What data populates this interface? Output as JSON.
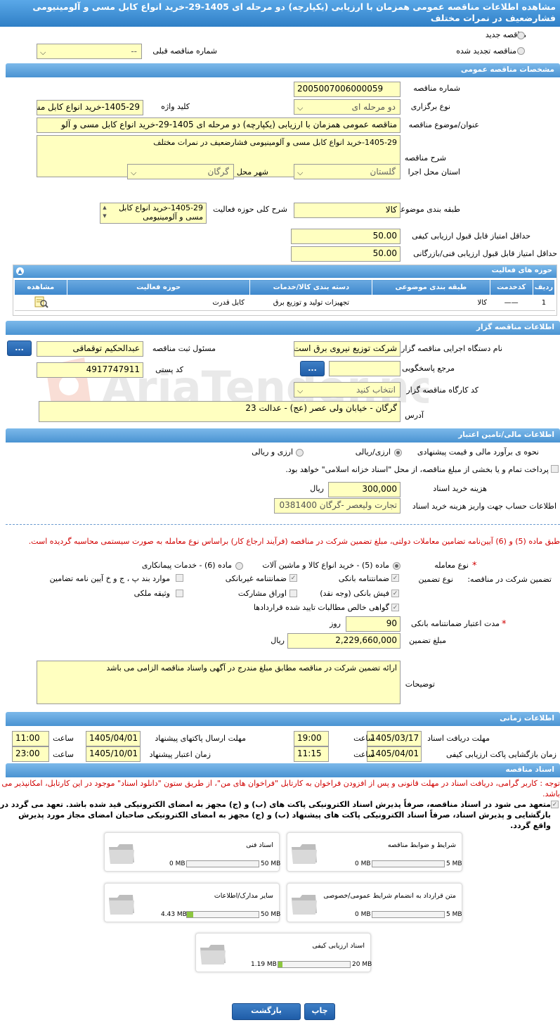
{
  "page_title": "مشاهده اطلاعات مناقصه عمومی همزمان با ارزیابی (یکپارچه) دو مرحله ای 1405-29-خرید انواع کابل مسی و آلومینیومی فشارضعیف در نمرات مختلف",
  "top": {
    "new_label": "مناقصه جدید",
    "renewed_label": "مناقصه تجدید شده",
    "prev_number_label": "شماره مناقصه قبلی",
    "prev_number_value": "--"
  },
  "general": {
    "header": "مشخصات مناقصه عمومی",
    "number_label": "شماره مناقصه",
    "number_value": "2005007006000059",
    "type_label": "نوع برگزاری",
    "type_value": "دو مرحله ای",
    "keyword_label": "کلید واژه",
    "keyword_value": "1405-29-خرید انواع کابل مس",
    "subject_label": "عنوان/موضوع مناقصه",
    "subject_value": "مناقصه عمومی همزمان با ارزیابی (یکپارچه) دو مرحله ای 1405-29-خرید انواع کابل مسی و آلو",
    "desc_label": "شرح مناقصه",
    "desc_value": "1405-29-خرید انواع کابل مسی و آلومینیومی فشارضعیف در نمرات مختلف",
    "province_label": "استان محل اجرا",
    "province_value": "گلستان",
    "city_label": "شهر محل اجرا",
    "city_value": "گرگان",
    "category_label": "طبقه بندی موضوعی",
    "category_value": "کالا",
    "scope_label": "شرح کلی حوزه فعالیت",
    "scope_value": "1405-29-خرید انواع کابل مسی و آلومینیومی",
    "min_quality_label": "حداقل امتیاز قابل قبول ارزیابی کیفی",
    "min_quality_value": "50.00",
    "min_tech_label": "حداقل امتیاز قابل قبول ارزیابی فنی/بازرگانی",
    "min_tech_value": "50.00"
  },
  "activities": {
    "header": "حوزه های فعالیت",
    "columns": [
      "ردیف",
      "کدخدمت",
      "طبقه بندی موضوعی",
      "دسته بندی کالا/خدمات",
      "حوزه فعالیت",
      "مشاهده"
    ],
    "rows": [
      {
        "row": "1",
        "code": "——",
        "category": "کالا",
        "group": "تجهیزات تولید و توزیع برق",
        "field": "کابل قدرت"
      }
    ]
  },
  "organizer": {
    "header": "اطلاعات مناقصه گزار",
    "device_label": "نام دستگاه اجرایی مناقصه گزار",
    "device_value": "شرکت توزیع نیروی برق است",
    "registrar_label": "مسئول ثبت مناقصه",
    "registrar_value": "عبدالحکیم توقماقی",
    "ref_label": "مرجع پاسخگویی",
    "ref_value": "",
    "postal_label": "کد پستی",
    "postal_value": "4917747911",
    "workshop_label": "کد کارگاه مناقصه گزار",
    "workshop_value": "انتخاب کنید",
    "address_label": "آدرس",
    "address_value": "گرگان - خیابان ولی عصر (عج) - عدالت 23",
    "btn": "..."
  },
  "finance": {
    "header": "اطلاعات مالی/تامین اعتبار",
    "estimate_label": "نحوه ی برآورد مالی و قیمت پیشنهادی",
    "opt1": "ارزی/ریالی",
    "opt2": "ارزی و ریالی",
    "treasury_text": "پرداخت تمام و یا بخشی از مبلغ مناقصه، از محل \"اسناد خزانه اسلامی\" خواهد بود.",
    "fee_label": "هزینه خرید اسناد",
    "fee_value": "300,000",
    "fee_unit": "ریال",
    "account_label": "اطلاعات حساب جهت واریز هزینه خرید اسناد",
    "account_value": "تجارت ولیعصر -گرگان 0381400"
  },
  "guarantee": {
    "note": "طبق ماده (5) و (6) آیین‌نامه تضامین معاملات دولتی، مبلغ تضمین شرکت در مناقصه (فرآیند ارجاع کار) براساس نوع معامله به صورت سیستمی محاسبه گردیده است.",
    "deal_label": "نوع معامله",
    "deal_opt1": "ماده (5) - خرید انواع کالا و ماشین آلات",
    "deal_opt2": "ماده (6) - خدمات پیمانکاری",
    "type_label": "تضمین شرکت در مناقصه:",
    "type_label2": "نوع تضمین",
    "c1": "ضمانتنامه بانکی",
    "c2": "ضمانتنامه غیربانکی",
    "c3": "موارد بند پ ، ج و خ آیین نامه تضامین",
    "c4": "فیش بانکی (وجه نقد)",
    "c5": "اوراق مشارکت",
    "c6": "وثیقه ملکی",
    "c7": "گواهی خالص مطالبات تایید شده قراردادها",
    "duration_label": "مدت اعتبار ضمانتنامه بانکی",
    "duration_value": "90",
    "duration_unit": "روز",
    "amount_label": "مبلغ تضمین",
    "amount_value": "2,229,660,000",
    "amount_unit": "ریال",
    "desc_label": "توضیحات",
    "desc_value": "ارائه تضمین شرکت در مناقصه مطابق مبلغ مندرج در آگهی واسناد مناقصه الزامی می باشد"
  },
  "timing": {
    "header": "اطلاعات زمانی",
    "receive_label": "مهلت دریافت اسناد",
    "receive_date": "1405/03/17",
    "receive_time": "19:00",
    "send_label": "مهلت ارسال پاکتهای پیشنهاد",
    "send_date": "1405/04/01",
    "send_time": "11:00",
    "open_label": "زمان بازگشایی پاکت ارزیابی کیفی",
    "open_date": "1405/04/01",
    "open_time": "11:15",
    "valid_label": "زمان اعتبار پیشنهاد",
    "valid_date": "1405/10/01",
    "valid_time": "23:00",
    "time_word": "ساعت"
  },
  "documents": {
    "header": "اسناد مناقصه",
    "note": "توجه : کاربر گرامی، دریافت اسناد در مهلت قانونی و پس از افزودن فراخوان به کارتابل \"فراخوان های من\"، از طریق ستون \"دانلود اسناد\" موجود در این کارتابل، امکانپذیر می باشد.",
    "pledge": "متعهد می شود در اسناد مناقصه، صرفاً پذیرش اسناد الکترونیکی پاکت های (ب) و (ج) مجهز به امضای الکترونیکی قید شده باشد. تعهد می گردد در بازگشایی و پذیرش اسناد، صرفاً اسناد الکترونیکی پاکت های پیشنهاد (ب) و (ج) مجهز به امضای الکترونیکی صاحبان امضای مجاز مورد پذیرش واقع گردد.",
    "items": [
      {
        "title": "شرایط و ضوابط مناقصه",
        "size": "0 MB",
        "max": "5 MB",
        "fill": 0
      },
      {
        "title": "اسناد فنی",
        "size": "0 MB",
        "max": "50 MB",
        "fill": 0
      },
      {
        "title": "متن قرارداد به انضمام شرایط عمومی/خصوصی",
        "size": "0 MB",
        "max": "5 MB",
        "fill": 0
      },
      {
        "title": "سایر مدارک/اطلاعات",
        "size": "4.43 MB",
        "max": "50 MB",
        "fill": 0.0886
      },
      {
        "title": "اسناد ارزیابی کیفی",
        "size": "1.19 MB",
        "max": "20 MB",
        "fill": 0.0595
      }
    ]
  },
  "buttons": {
    "print": "چاپ",
    "back": "بازگشت"
  },
  "watermark": "AriaTender.neT"
}
